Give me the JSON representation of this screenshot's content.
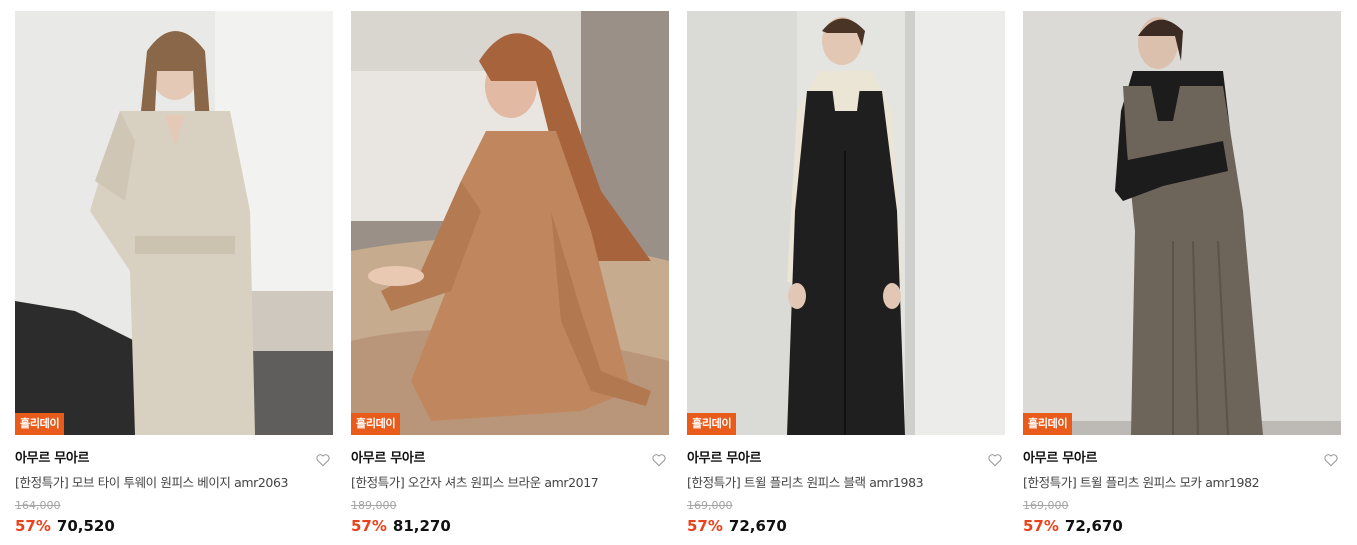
{
  "products": [
    {
      "badge": "홀리데이",
      "brand": "아무르 무아르",
      "title": "[한정특가] 모브 타이 투웨이 원피스 베이지 amr2063",
      "original_price": "164,000",
      "discount": "57%",
      "price": "70,520",
      "image": "model-beige-wrap-dress-photo"
    },
    {
      "badge": "홀리데이",
      "brand": "아무르 무아르",
      "title": "[한정특가] 오간자 셔츠 원피스 브라운 amr2017",
      "original_price": "189,000",
      "discount": "57%",
      "price": "81,270",
      "image": "model-brown-shirt-dress-photo"
    },
    {
      "badge": "홀리데이",
      "brand": "아무르 무아르",
      "title": "[한정특가] 트윌 플리츠 원피스 블랙 amr1983",
      "original_price": "169,000",
      "discount": "57%",
      "price": "72,670",
      "image": "model-black-pleats-dress-photo"
    },
    {
      "badge": "홀리데이",
      "brand": "아무르 무아르",
      "title": "[한정특가] 트윌 플리츠 원피스 모카 amr1982",
      "original_price": "169,000",
      "discount": "57%",
      "price": "72,670",
      "image": "model-mocha-pleats-dress-photo"
    }
  ],
  "icons": {
    "wishlist": "heart-outline-icon"
  },
  "colors": {
    "badge_bg": "#e85b1b",
    "discount": "#e8421b",
    "strike": "#a5a5a5"
  }
}
